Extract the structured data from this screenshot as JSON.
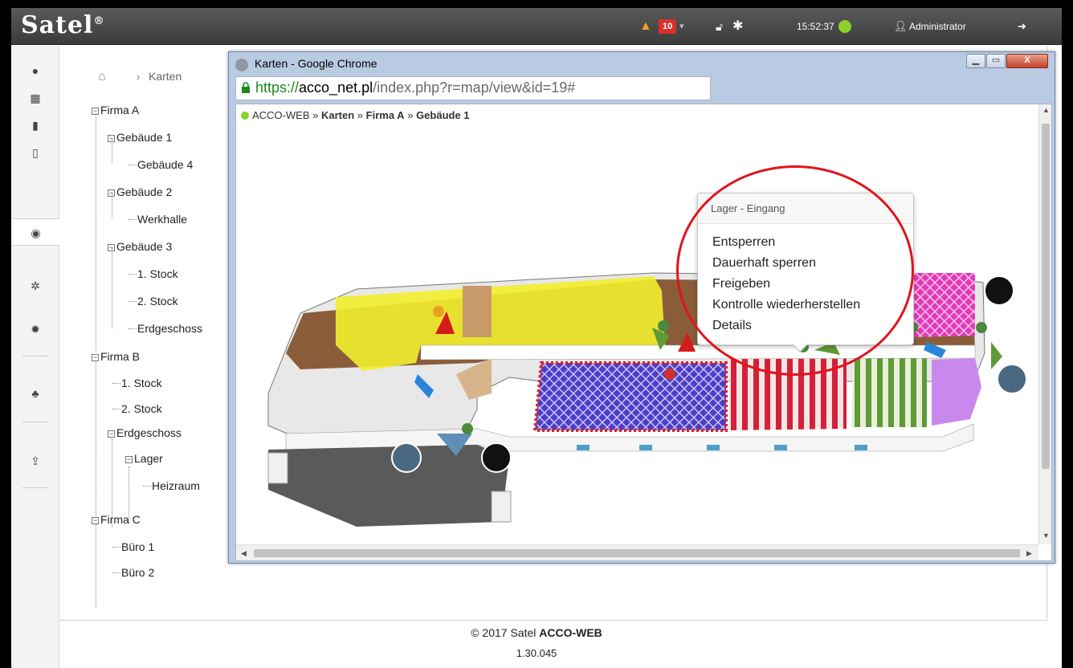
{
  "header": {
    "logo": "Satel",
    "logo_mark": "®",
    "alarm_count": "10",
    "time": "15:52:37",
    "user": "Administrator",
    "status_color": "#8cd12a"
  },
  "breadcrumb": {
    "current": "Karten"
  },
  "tree": {
    "firma_a": "Firma A",
    "geb1": "Gebäude 1",
    "geb4": "Gebäude 4",
    "geb2": "Gebäude 2",
    "werkhalle": "Werkhalle",
    "geb3": "Gebäude 3",
    "stock1": "1. Stock",
    "stock2": "2. Stock",
    "erdgeschoss": "Erdgeschoss",
    "firma_b": "Firma B",
    "b_stock1": "1. Stock",
    "b_stock2": "2. Stock",
    "b_erdgeschoss": "Erdgeschoss",
    "lager": "Lager",
    "heizraum": "Heizraum",
    "firma_c": "Firma C",
    "buero1": "Büro 1",
    "buero2": "Büro 2"
  },
  "browser": {
    "title": "Karten - Google Chrome",
    "url_scheme": "https://",
    "url_host": "acco_net.pl",
    "url_path": "/index.php?r=map/view&id=19#",
    "close_label": "X"
  },
  "page": {
    "bc_root": "ACCO-WEB",
    "bc_sep": "»",
    "bc_1": "Karten",
    "bc_2": "Firma A",
    "bc_3": "Gebäude 1"
  },
  "popup": {
    "title": "Lager - Eingang",
    "items": [
      "Entsperren",
      "Dauerhaft sperren",
      "Freigeben",
      "Kontrolle wiederherstellen",
      "Details"
    ]
  },
  "footer": {
    "copyright": "© 2017 Satel",
    "product": "ACCO-WEB",
    "version": "1.30.045"
  }
}
